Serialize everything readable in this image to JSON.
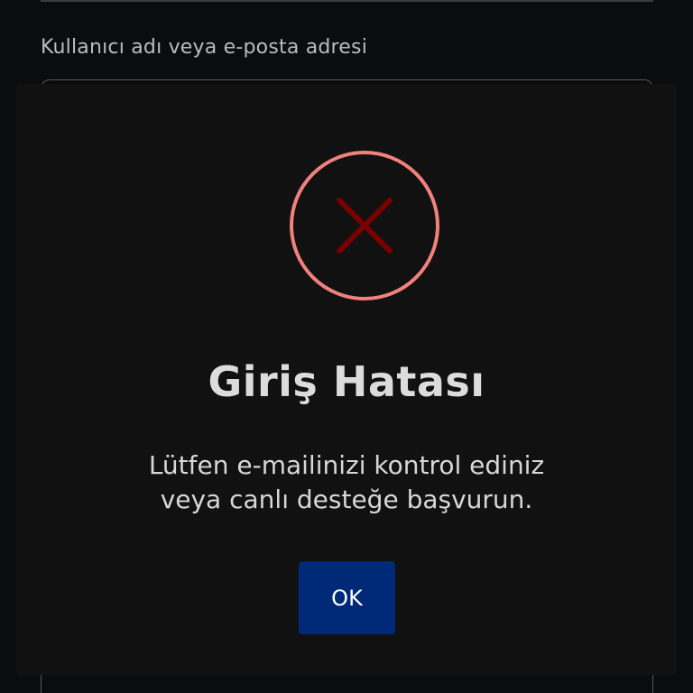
{
  "login_form": {
    "username_label": "Kullanıcı adı veya e-posta adresi"
  },
  "error_dialog": {
    "icon": "error-x-circle-icon",
    "title": "Giriş Hatası",
    "message_line1": "Lütfen e-mailinizi kontrol ediniz",
    "message_line2": "veya canlı desteğe başvurun.",
    "ok_label": "OK"
  },
  "colors": {
    "background": "#0b0c10",
    "dialog_background": "#111111",
    "error_ring": "#f2817d",
    "error_x": "#7a0000",
    "ok_button": "#002a77"
  }
}
